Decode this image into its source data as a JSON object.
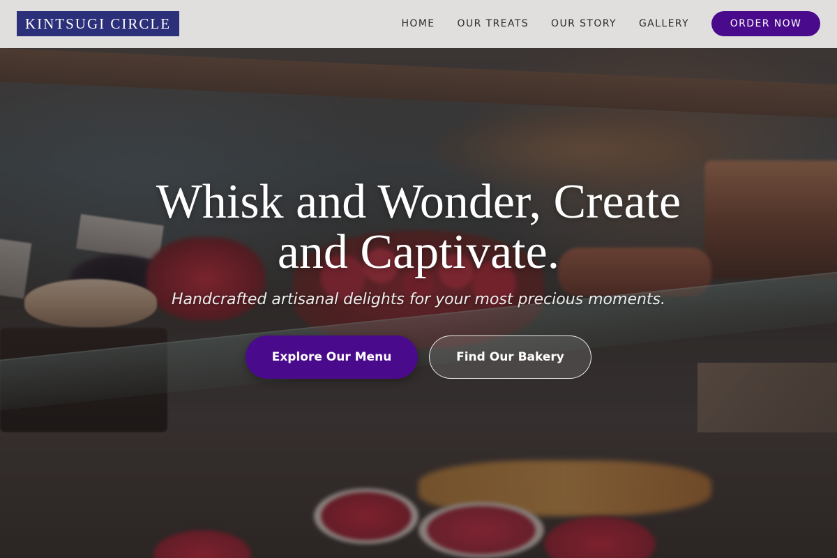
{
  "header": {
    "logo_text": "KINTSUGI CIRCLE",
    "nav": [
      {
        "label": "HOME"
      },
      {
        "label": "OUR TREATS"
      },
      {
        "label": "OUR STORY"
      },
      {
        "label": "GALLERY"
      }
    ],
    "cta_label": "ORDER NOW"
  },
  "hero": {
    "title_line1": "Whisk and Wonder, Create",
    "title_line2": "and Captivate.",
    "subtitle": "Handcrafted artisanal delights for your most precious moments.",
    "primary_button": "Explore Our Menu",
    "secondary_button": "Find Our Bakery"
  },
  "colors": {
    "brand_purple": "#4a0a8c",
    "logo_navy": "#2c2f7a",
    "header_bg": "#e8e6e5"
  }
}
